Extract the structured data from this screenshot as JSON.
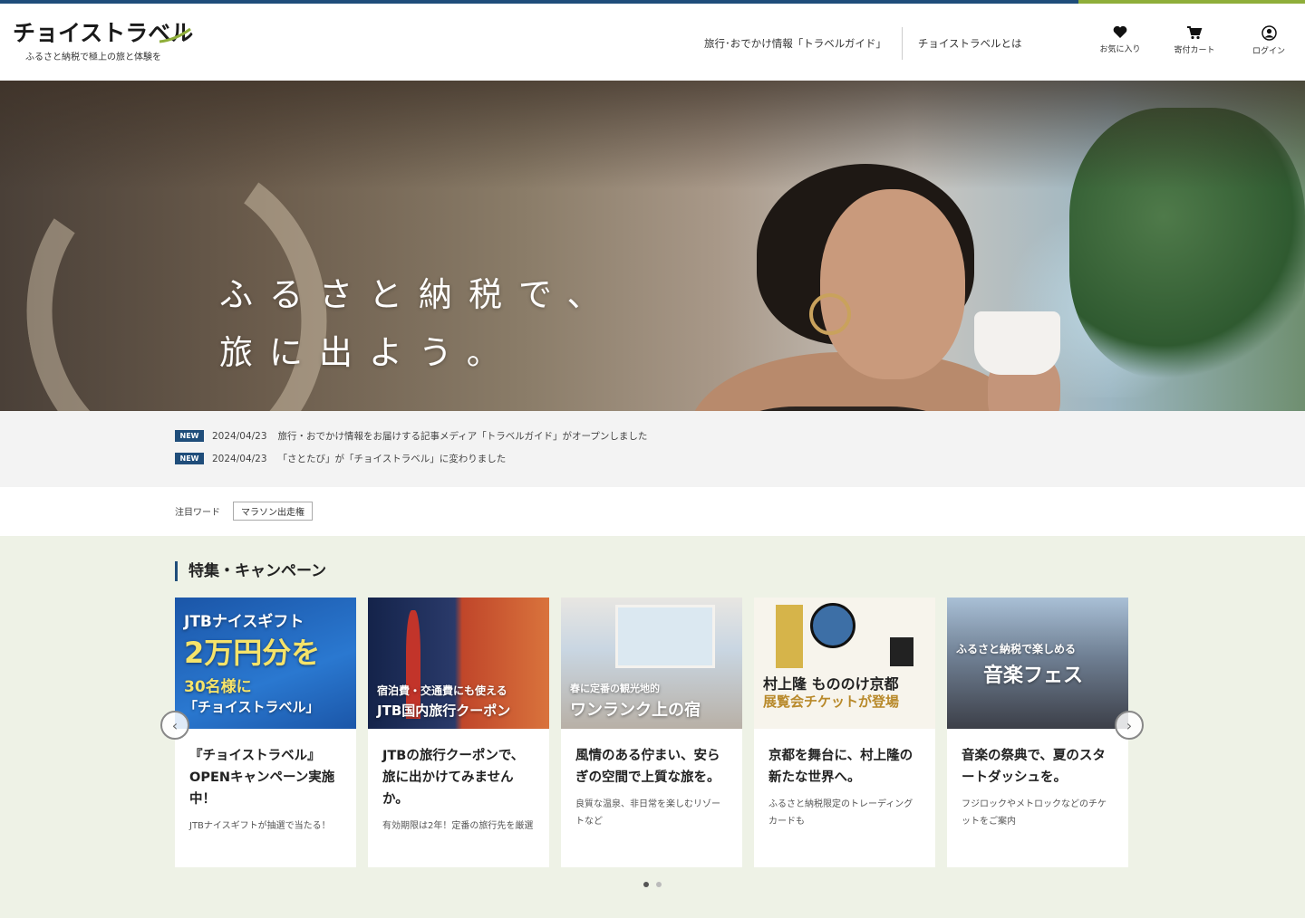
{
  "header": {
    "logo": "チョイストラベル",
    "tagline": "ふるさと納税で極上の旅と体験を",
    "nav": [
      {
        "label": "旅行･おでかけ情報「トラベルガイド」"
      },
      {
        "label": "チョイストラベルとは"
      }
    ],
    "icons": [
      {
        "icon": "heart-icon",
        "label": "お気に入り"
      },
      {
        "icon": "cart-icon",
        "label": "寄付カート"
      },
      {
        "icon": "user-icon",
        "label": "ログイン"
      }
    ]
  },
  "hero": {
    "line1": "ふるさと納税で、",
    "line2": "旅に出よう。"
  },
  "news": [
    {
      "badge": "NEW",
      "date": "2024/04/23",
      "text": "旅行・おでかけ情報をお届けする記事メディア「トラベルガイド」がオープンしました"
    },
    {
      "badge": "NEW",
      "date": "2024/04/23",
      "text": "「さとたび」が「チョイストラベル」に変わりました"
    }
  ],
  "keywords": {
    "label": "注目ワード",
    "tags": [
      "マラソン出走権"
    ]
  },
  "feature": {
    "title": "特集・キャンペーン",
    "cards": [
      {
        "thumb_text": [
          "JTBナイスギフト",
          "2万円分を",
          "30名様に",
          "「チョイストラベル」"
        ],
        "title": "『チョイストラベル』OPENキャンペーン実施中！",
        "desc": "JTBナイスギフトが抽選で当たる！"
      },
      {
        "thumb_text": [
          "宿泊費・交通費にも使える",
          "JTB国内旅行クーポン"
        ],
        "title": "JTBの旅行クーポンで、旅に出かけてみませんか。",
        "desc": "有効期限は2年！定番の旅行先を厳選"
      },
      {
        "thumb_text": [
          "春に定番の観光地的",
          "ワンランク上の宿"
        ],
        "title": "風情のある佇まい、安らぎの空間で上質な旅を。",
        "desc": "良質な温泉、非日常を楽しむリゾートなど"
      },
      {
        "thumb_text": [
          "村上隆 もののけ京都",
          "展覧会チケットが登場"
        ],
        "title": "京都を舞台に、村上隆の新たな世界へ。",
        "desc": "ふるさと納税限定のトレーディングカードも"
      },
      {
        "thumb_text": [
          "ふるさと納税で楽しめる",
          "音楽フェス"
        ],
        "title": "音楽の祭典で、夏のスタートダッシュを。",
        "desc": "フジロックやメトロックなどのチケットをご案内"
      }
    ],
    "prev_arrow": "‹",
    "next_arrow": "›"
  },
  "colors": {
    "brand": "#1f4d7a",
    "accent": "#8fae3a",
    "feature_bg": "#eef2e6"
  }
}
